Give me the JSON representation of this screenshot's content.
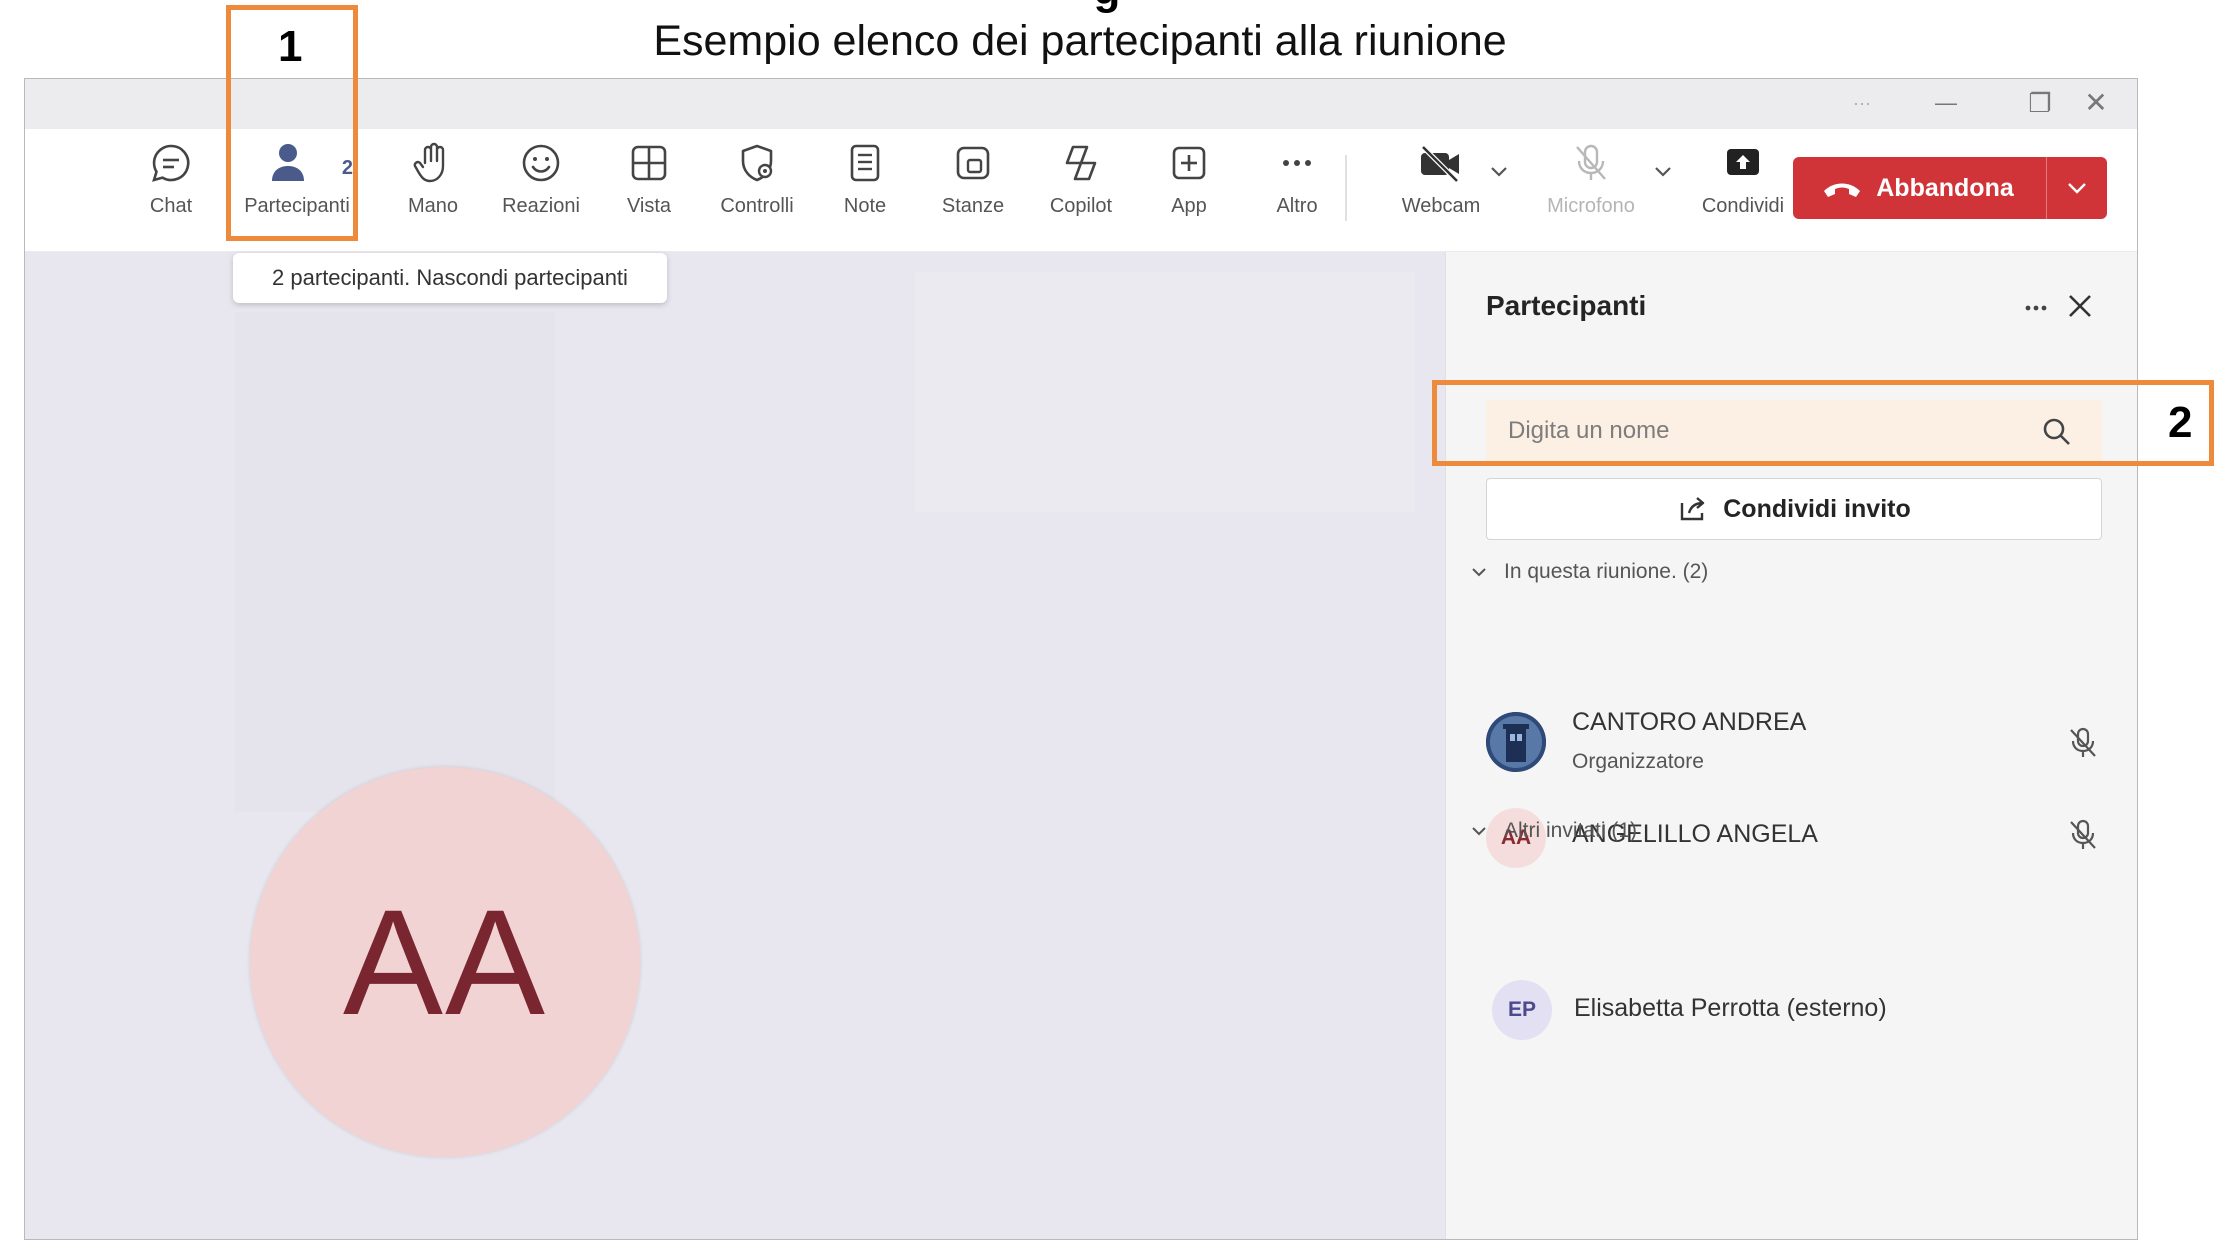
{
  "figure": {
    "caption_partial": "g",
    "caption": "Esempio elenco dei partecipanti alla riunione",
    "callout_1": "1",
    "callout_2": "2",
    "highlight_color": "#ee8a3c"
  },
  "window": {
    "controls": {
      "more": "···",
      "minimize": "—",
      "restore": "❐",
      "close": "✕"
    }
  },
  "toolbar": {
    "items": [
      {
        "label": "Chat",
        "icon": "chat-icon"
      },
      {
        "label": "Partecipanti",
        "icon": "people-icon",
        "badge": "2",
        "active": true
      },
      {
        "label": "Mano",
        "icon": "raise-hand-icon"
      },
      {
        "label": "Reazioni",
        "icon": "smiley-icon"
      },
      {
        "label": "Vista",
        "icon": "grid-view-icon"
      },
      {
        "label": "Controlli",
        "icon": "shield-gear-icon"
      },
      {
        "label": "Note",
        "icon": "notes-icon"
      },
      {
        "label": "Stanze",
        "icon": "rooms-icon"
      },
      {
        "label": "Copilot",
        "icon": "copilot-icon"
      },
      {
        "label": "App",
        "icon": "add-app-icon"
      },
      {
        "label": "Altro",
        "icon": "more-icon"
      },
      {
        "label": "Webcam",
        "icon": "camera-off-icon"
      },
      {
        "label": "Microfono",
        "icon": "mic-off-icon",
        "disabled": true
      },
      {
        "label": "Condividi",
        "icon": "share-screen-icon"
      }
    ],
    "leave": {
      "label": "Abbandona",
      "color": "#d13438"
    }
  },
  "tooltip": "2 partecipanti. Nascondi partecipanti",
  "stage": {
    "avatar_initials": "AA",
    "avatar_bg": "#f2d3d4",
    "avatar_fg": "#7a2630"
  },
  "panel": {
    "title": "Partecipanti",
    "search_placeholder": "Digita un nome",
    "share_invite": "Condividi invito",
    "groups": [
      {
        "title": "In questa riunione. (2)",
        "people": [
          {
            "name": "CANTORO ANDREA",
            "role": "Organizzatore",
            "avatar": "photo"
          },
          {
            "name": "ANGELILLO ANGELA",
            "initials": "AA",
            "avatar_bg": "#f6dddd",
            "avatar_fg": "#8a2a32"
          }
        ]
      },
      {
        "title": "Altri invitati (1)",
        "people": [
          {
            "name": "Elisabetta Perrotta (esterno)",
            "initials": "EP",
            "avatar_bg": "#e3e0f3",
            "avatar_fg": "#4b4a8c"
          }
        ]
      }
    ]
  }
}
